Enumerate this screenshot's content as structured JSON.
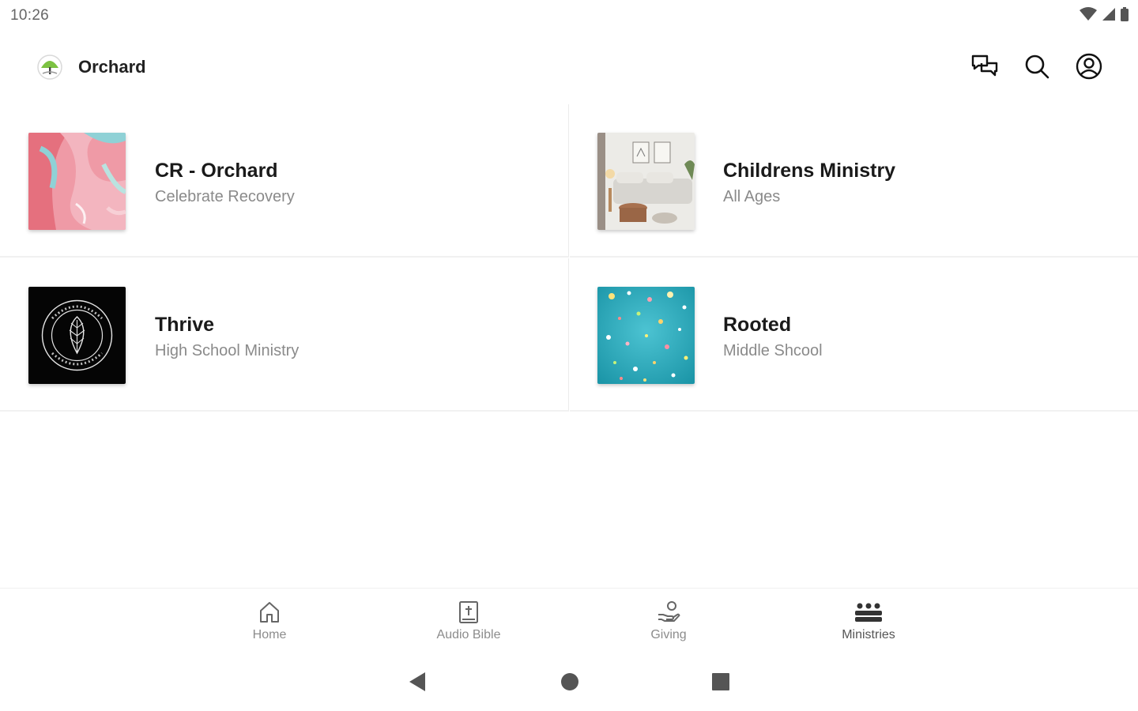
{
  "status_bar": {
    "time": "10:26",
    "icons": [
      "wifi-icon",
      "signal-icon",
      "battery-icon"
    ]
  },
  "app_bar": {
    "title": "Orchard",
    "actions": [
      "chat-icon",
      "search-icon",
      "account-icon"
    ]
  },
  "ministries": [
    {
      "title": "CR - Orchard",
      "subtitle": "Celebrate Recovery",
      "image": "pink-marble-abstract"
    },
    {
      "title": "Childrens Ministry",
      "subtitle": "All Ages",
      "image": "living-room-sofa"
    },
    {
      "title": "Thrive",
      "subtitle": "High School Ministry",
      "image": "leaf-emblem-black"
    },
    {
      "title": "Rooted",
      "subtitle": "Middle Shcool",
      "image": "teal-confetti"
    }
  ],
  "bottom_nav": [
    {
      "label": "Home",
      "icon": "home-icon",
      "active": false
    },
    {
      "label": "Audio Bible",
      "icon": "bible-icon",
      "active": false
    },
    {
      "label": "Giving",
      "icon": "giving-icon",
      "active": false
    },
    {
      "label": "Ministries",
      "icon": "people-group-icon",
      "active": true
    }
  ],
  "system_nav": [
    "back-icon",
    "home-circle-icon",
    "recents-icon"
  ],
  "colors": {
    "text_primary": "#1a1a1a",
    "text_secondary": "#8a8a8a",
    "nav_label": "#8c8c8c",
    "logo_green": "#7cc242"
  }
}
